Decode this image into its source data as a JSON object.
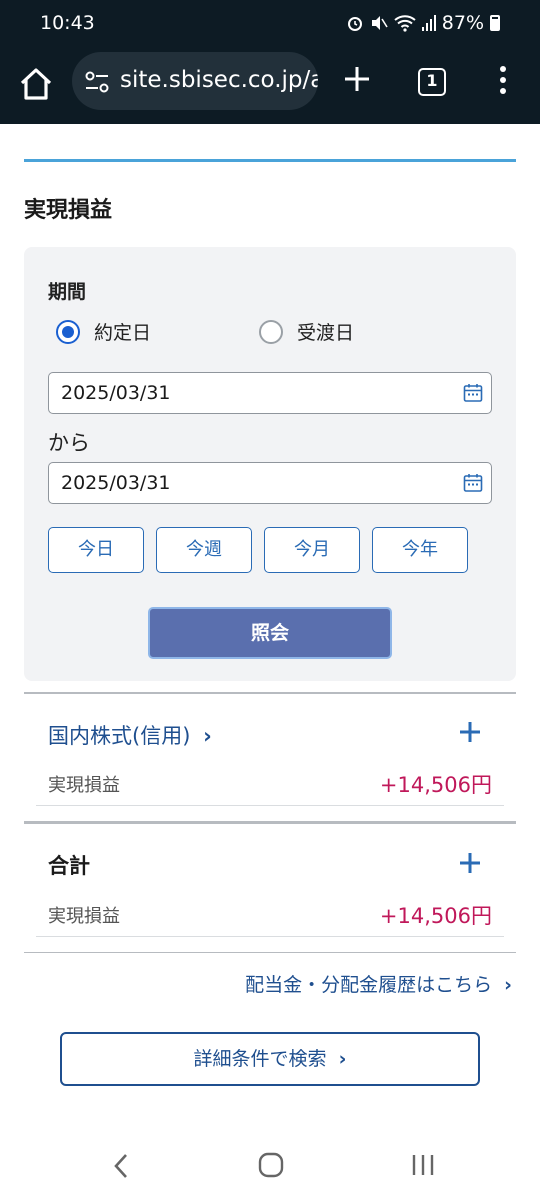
{
  "status_bar": {
    "time": "10:43",
    "battery": "87%"
  },
  "browser": {
    "url": "site.sbisec.co.jp/a",
    "tab_count": "1"
  },
  "page": {
    "section_title": "実現損益",
    "filter": {
      "period_label": "期間",
      "radio_options": [
        {
          "label": "約定日",
          "selected": true
        },
        {
          "label": "受渡日",
          "selected": false
        }
      ],
      "date_from": "2025/03/31",
      "range_separator": "から",
      "date_to": "2025/03/31",
      "quick_buttons": [
        "今日",
        "今週",
        "今月",
        "今年"
      ],
      "search_button": "照会"
    },
    "groups": [
      {
        "title": "国内株式(信用)",
        "chevron": "›",
        "row_label": "実現損益",
        "row_value": "+14,506円"
      },
      {
        "title": "合計",
        "row_label": "実現損益",
        "row_value": "+14,506円"
      }
    ],
    "dividend_link": "配当金・分配金履歴はこちら",
    "detail_search_button": "詳細条件で検索",
    "colors": {
      "accent": "#2a6bb5",
      "profit": "#c0185a",
      "search_button": "#5a6fae",
      "top_rule": "#4aa3d9"
    }
  },
  "icons": [
    "home-icon",
    "tune-icon",
    "plus-icon",
    "tabs-icon",
    "more-icon",
    "calendar-icon",
    "chevron-right-icon",
    "back-icon",
    "home-nav-icon",
    "recents-icon"
  ]
}
